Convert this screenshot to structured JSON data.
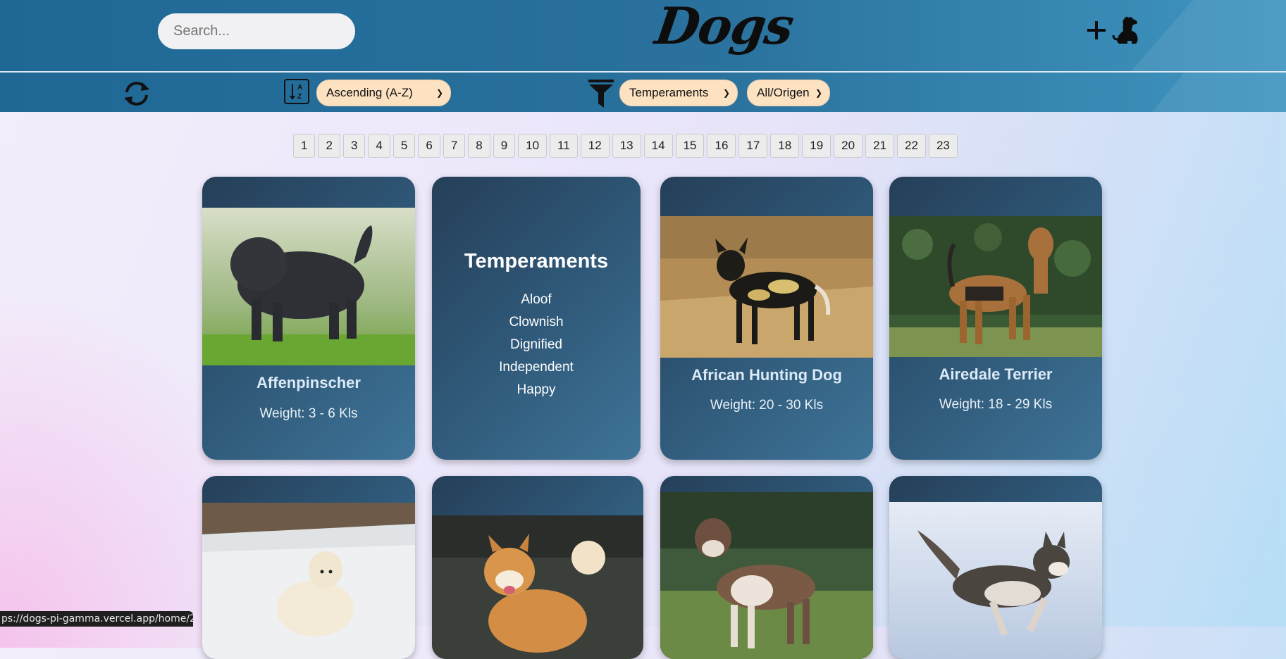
{
  "header": {
    "search_placeholder": "Search...",
    "logo": "Dogs",
    "add_dog_label": "+"
  },
  "toolbar": {
    "sort_selected": "Ascending (A-Z)",
    "temperaments_selected": "Temperaments",
    "origin_selected": "All/Origen"
  },
  "pagination": [
    "1",
    "2",
    "3",
    "4",
    "5",
    "6",
    "7",
    "8",
    "9",
    "10",
    "11",
    "12",
    "13",
    "14",
    "15",
    "16",
    "17",
    "18",
    "19",
    "20",
    "21",
    "22",
    "23"
  ],
  "cards": [
    {
      "name": "Affenpinscher",
      "weight": "Weight: 3 - 6 Kls"
    },
    {
      "temperaments_title": "Temperaments",
      "temperaments": [
        "Aloof",
        "Clownish",
        "Dignified",
        "Independent",
        "Happy"
      ]
    },
    {
      "name": "African Hunting Dog",
      "weight": "Weight: 20 - 30 Kls"
    },
    {
      "name": "Airedale Terrier",
      "weight": "Weight: 18 - 29 Kls"
    }
  ],
  "status_bar_url": "ps://dogs-pi-gamma.vercel.app/home/2",
  "colors": {
    "header_bg": "#2a719d",
    "card_bg": "#2f5878",
    "select_bg": "#fde2c2"
  },
  "icons": [
    "search-icon",
    "plus-icon",
    "dog-icon",
    "reload-icon",
    "sort-az-icon",
    "filter-icon",
    "chevron-down-icon"
  ]
}
